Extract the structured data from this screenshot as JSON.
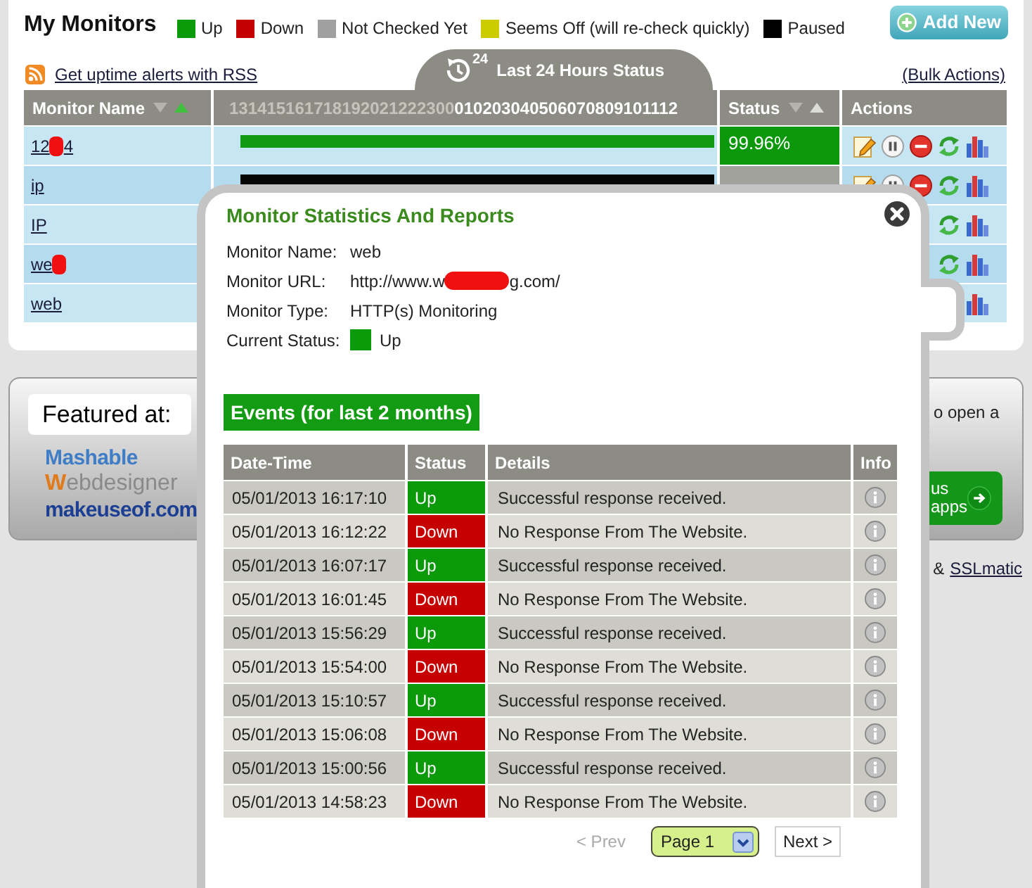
{
  "header": {
    "title": "My Monitors",
    "add_button": "Add New"
  },
  "legend": [
    {
      "label": "Up",
      "color": "#0a9a0a"
    },
    {
      "label": "Down",
      "color": "#c40000"
    },
    {
      "label": "Not Checked Yet",
      "color": "#a0a0a0"
    },
    {
      "label": "Seems Off (will re-check quickly)",
      "color": "#cccc00"
    },
    {
      "label": "Paused",
      "color": "#000000"
    }
  ],
  "toolbar": {
    "rss_link": "Get uptime alerts with RSS",
    "tab_label": "Last 24 Hours Status",
    "clock_badge": "24",
    "bulk_actions": "(Bulk Actions)"
  },
  "table": {
    "columns": [
      {
        "kind": "name",
        "label": "Monitor Name",
        "sorted_ascending": true
      },
      {
        "kind": "hours",
        "past_hours": "131415161718192021222300",
        "today_hours": "010203040506070809101112"
      },
      {
        "kind": "status",
        "label": "Status",
        "sorted_ascending": false
      },
      {
        "kind": "actions",
        "label": "Actions"
      }
    ],
    "rows": [
      {
        "name": "12",
        "name_after": "4",
        "redacted": true,
        "paused": false,
        "uptime": "99.96%"
      },
      {
        "name": "ip",
        "redacted": false,
        "paused": true
      },
      {
        "name": "IP",
        "redacted": false
      },
      {
        "name": "we",
        "redacted": true
      },
      {
        "name": "web",
        "redacted": false
      }
    ]
  },
  "featured": {
    "title": "Featured at:",
    "logos": [
      {
        "kind": "mashable",
        "text": "Mashable"
      },
      {
        "kind": "webdesigner",
        "text": "Webdesigner"
      },
      {
        "kind": "makeuseof",
        "text": "makeuseof.com"
      }
    ]
  },
  "promo": {
    "text": "o open a",
    "button_lines": [
      "us",
      "apps"
    ]
  },
  "footer_links": {
    "prefix": "&",
    "link": "SSLmatic"
  },
  "popup": {
    "title": "Monitor Statistics And Reports",
    "fields": [
      {
        "kind": "text",
        "label": "Monitor Name:",
        "value": "web"
      },
      {
        "kind": "url",
        "label": "Monitor URL:",
        "value": "http://www.w",
        "value_after": "g.com/",
        "redacted": true
      },
      {
        "kind": "text",
        "label": "Monitor Type:",
        "value": "HTTP(s) Monitoring"
      },
      {
        "kind": "status",
        "label": "Current Status:",
        "value": "Up",
        "color": "#0a9a0a"
      }
    ],
    "events_title": "Events (for last 2 months)",
    "events_columns": [
      "Date-Time",
      "Status",
      "Details",
      "Info"
    ],
    "events": [
      {
        "time": "05/01/2013 16:17:10",
        "status": "Up",
        "kind": "up",
        "details": "Successful response received."
      },
      {
        "time": "05/01/2013 16:12:22",
        "status": "Down",
        "kind": "down",
        "details": "No Response From The Website."
      },
      {
        "time": "05/01/2013 16:07:17",
        "status": "Up",
        "kind": "up",
        "details": "Successful response received."
      },
      {
        "time": "05/01/2013 16:01:45",
        "status": "Down",
        "kind": "down",
        "details": "No Response From The Website."
      },
      {
        "time": "05/01/2013 15:56:29",
        "status": "Up",
        "kind": "up",
        "details": "Successful response received."
      },
      {
        "time": "05/01/2013 15:54:00",
        "status": "Down",
        "kind": "down",
        "details": "No Response From The Website."
      },
      {
        "time": "05/01/2013 15:10:57",
        "status": "Up",
        "kind": "up",
        "details": "Successful response received."
      },
      {
        "time": "05/01/2013 15:06:08",
        "status": "Down",
        "kind": "down",
        "details": "No Response From The Website."
      },
      {
        "time": "05/01/2013 15:00:56",
        "status": "Up",
        "kind": "up",
        "details": "Successful response received."
      },
      {
        "time": "05/01/2013 14:58:23",
        "status": "Down",
        "kind": "down",
        "details": "No Response From The Website."
      }
    ],
    "pagination": {
      "prev": "< Prev",
      "prev_disabled": true,
      "page": "Page 1",
      "next": "Next >"
    }
  }
}
